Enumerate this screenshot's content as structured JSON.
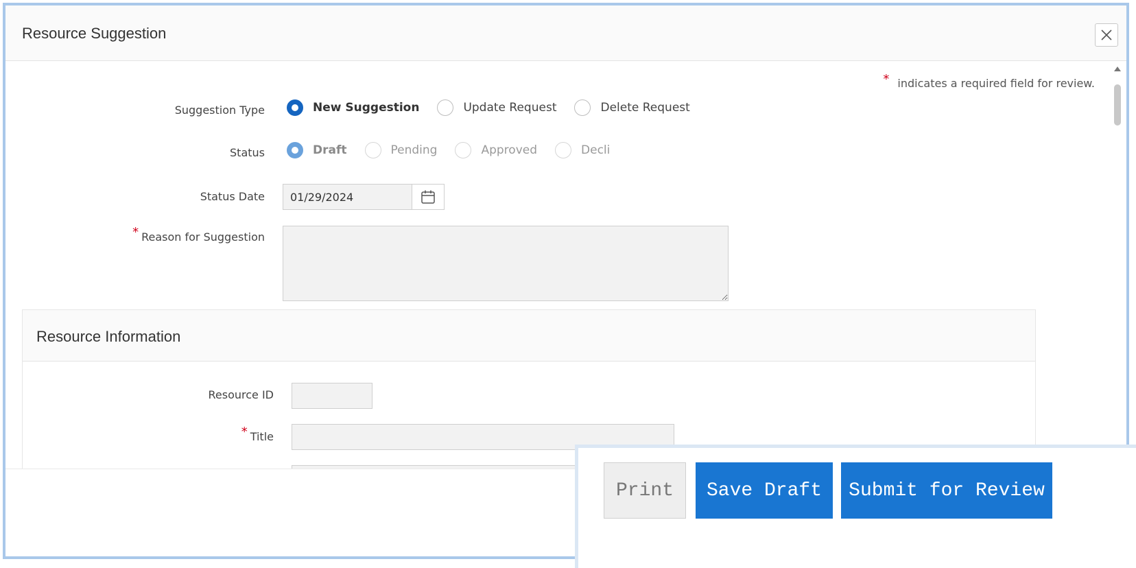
{
  "dialog": {
    "title": "Resource Suggestion",
    "required_note": "indicates a required field for review.",
    "required_marker": "*"
  },
  "form": {
    "suggestion_type": {
      "label": "Suggestion Type",
      "options": [
        "New Suggestion",
        "Update Request",
        "Delete Request"
      ],
      "selected": "New Suggestion"
    },
    "status": {
      "label": "Status",
      "options": [
        "Draft",
        "Pending",
        "Approved",
        "Decli"
      ],
      "selected": "Draft",
      "disabled": true
    },
    "status_date": {
      "label": "Status Date",
      "value": "01/29/2024"
    },
    "reason": {
      "label": "Reason for Suggestion",
      "value": "",
      "required": true
    }
  },
  "resource_information": {
    "title": "Resource Information",
    "resource_id": {
      "label": "Resource ID",
      "value": ""
    },
    "title_field": {
      "label": "Title",
      "value": "",
      "required": true
    }
  },
  "footer": {
    "print_label": "Print",
    "save_draft_label": "Save Draft",
    "submit_label": "Submit for Review"
  },
  "colors": {
    "accent": "#1976d2",
    "radio_selected": "#1565c0",
    "required": "#d0021b",
    "dialog_border": "#a9c8ea"
  }
}
